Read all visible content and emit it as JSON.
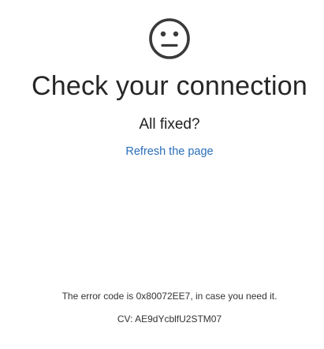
{
  "error_page": {
    "icon": "neutral-face-icon",
    "title": "Check your connection",
    "subtitle": "All fixed?",
    "refresh_link": "Refresh the page",
    "error_code_text": "The error code is 0x80072EE7, in case you need it.",
    "cv_text": "CV: AE9dYcblfU2STM07"
  },
  "colors": {
    "background": "#ffffff",
    "icon": "#3a3a3a",
    "title": "#262626",
    "link": "#2a6fba",
    "small_text": "#333333"
  }
}
